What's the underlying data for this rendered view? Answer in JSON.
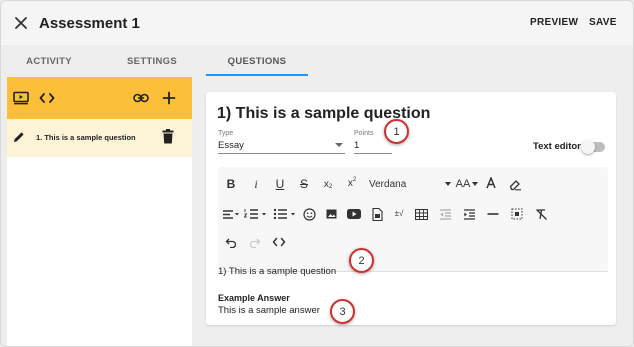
{
  "header": {
    "title": "Assessment 1",
    "preview_label": "PREVIEW",
    "save_label": "SAVE"
  },
  "tabs": [
    {
      "label": "ACTIVITY",
      "active": false
    },
    {
      "label": "SETTINGS",
      "active": false
    },
    {
      "label": "QUESTIONS",
      "active": true
    }
  ],
  "sidebar": {
    "toolbar_icons": [
      "preview-icon",
      "code-icon",
      "link-icon",
      "add-icon"
    ],
    "toolbar_color": "#fcbf3a",
    "questions": [
      {
        "label": "1. This is a sample question",
        "selected": true
      }
    ]
  },
  "question": {
    "title": "1) This is a sample question",
    "type_label": "Type",
    "type_value": "Essay",
    "points_label": "Points",
    "points_value": "1",
    "text_editor_label": "Text editor",
    "text_editor_on": false
  },
  "editor": {
    "font": "Verdana",
    "font_size_label": "AA",
    "content": "1)  This is a sample question",
    "example_answer_title": "Example Answer",
    "example_answer": "This is a sample answer"
  },
  "callouts": [
    "1",
    "2",
    "3"
  ],
  "colors": {
    "accent": "#2196f3",
    "callout_border": "#d32f2f",
    "selected_row": "#fdf4d8"
  }
}
